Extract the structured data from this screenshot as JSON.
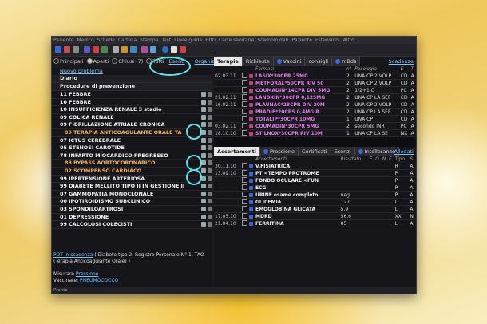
{
  "menu": [
    "Paziente",
    "Medico",
    "Schede",
    "Cartella",
    "Stampa",
    "Test",
    "Linee guida",
    "Filtri",
    "Carte sanitarie",
    "Scambio dati",
    "Paziente",
    "Estensioni",
    "Altro"
  ],
  "filters": {
    "options": [
      "Principali",
      "Aperti",
      "Chiusi (7)",
      "Tutti"
    ],
    "esenti_link": "Esenti",
    "organizza_link": "Organizza"
  },
  "left": {
    "new_problem": "Nuovo problema",
    "headers": [
      "Diario",
      "Procedure di prevenzione"
    ],
    "problems": [
      {
        "label": "11 FEBBRE",
        "sub": false
      },
      {
        "label": "10 FEBBRE",
        "sub": false
      },
      {
        "label": "10 INSUFFICIENZA RENALE 3 stadio",
        "sub": false
      },
      {
        "label": "09 COLICA RENALE",
        "sub": false
      },
      {
        "label": "09 FIBRILLAZIONE ATRIALE CRONICA",
        "sub": false
      },
      {
        "label": "09 TERAPIA ANTICOAGULANTE ORALE TA",
        "sub": true
      },
      {
        "label": "07 ICTUS CEREBRALE",
        "sub": false
      },
      {
        "label": "05 STENOSI CAROTIDE",
        "sub": false
      },
      {
        "label": "78 INFARTO MIOCARDICO PREGRESSO",
        "sub": false
      },
      {
        "label": "83 BYPASS AORTOCORONARICO",
        "sub": true
      },
      {
        "label": "02 SCOMPENSO CARDIACO",
        "sub": true
      },
      {
        "label": "99 IPERTENSIONE ARTERIOSA",
        "sub": false
      },
      {
        "label": "99 DIABETE MELLITO TIPO II IN GESTIONE II",
        "sub": false
      },
      {
        "label": "07 GAMMOPATIA MONOCLONALE",
        "sub": false
      },
      {
        "label": "00 IPOTIROIDISMO SUBCLINICO",
        "sub": false
      },
      {
        "label": "03 SPONDILOARTROSI",
        "sub": false
      },
      {
        "label": "01 DEPRESSIONE",
        "sub": false
      },
      {
        "label": "99 CALCOLOSI COLECISTI",
        "sub": false
      }
    ],
    "footer": {
      "pdt_link": "PDT in scadenza",
      "pdt_rest": "( Diabete tipo 2, Registro Personale N° 1, TAO (Terapia Anticoagulante Orale) )",
      "misurare_label": "Misurare",
      "misurare_link": "Pressione",
      "vaccinare_label": "Vaccinare:",
      "vaccinare_link": "PNEUMOCOCCO"
    }
  },
  "therapy": {
    "tabs": [
      "Terapie",
      "Richieste",
      "Vaccini",
      "consigli",
      "mBds"
    ],
    "scadenze_link": "Scadenze",
    "columns": [
      "Farmaci",
      "n°",
      "Posologia",
      "E",
      "T"
    ],
    "rows": [
      {
        "date": "02.03.11",
        "name": "LASIX*30CPR 25MG",
        "n": "2",
        "pos": "UNA CP 2 VOLP",
        "e": "CD",
        "t": "A"
      },
      {
        "date": "",
        "name": "METFORAL*50CPR RIV 50",
        "n": "2",
        "pos": "UNA CP 2 VOLP",
        "e": "CD",
        "t": "A"
      },
      {
        "date": "",
        "name": "COUMADIN*14CPR DIV 5MG",
        "n": "2",
        "pos": "1/2+1 C",
        "e": "PC",
        "t": "A"
      },
      {
        "date": "21.02.11",
        "name": "LANOXIN*30CPR 0,125MG",
        "n": "2",
        "pos": "UNA CP LA SEF",
        "e": "CD",
        "t": "A"
      },
      {
        "date": "16.02.11",
        "name": "PLAUNAC*28CPR DIV 20M",
        "n": "2",
        "pos": "UNA CP 2 VOLP",
        "e": "CD",
        "t": "A"
      },
      {
        "date": "",
        "name": "PRADIF*20CPS 0,4MG R.",
        "n": "2",
        "pos": "UNA CP LA SEF",
        "e": "CD",
        "t": "A"
      },
      {
        "date": "",
        "name": "TOTALIP*30CPR 10MG",
        "n": "1",
        "pos": "UNA CP",
        "e": "CD",
        "t": "A"
      },
      {
        "date": "03.02.11",
        "name": "COUMADIN*30CPR 5MG",
        "n": "2",
        "pos": "secondo INR",
        "e": "PC",
        "t": "A"
      },
      {
        "date": "18.10.10",
        "name": "STILNOX*30CPR RIV 10M",
        "n": "1",
        "pos": "UNA CP LA SE",
        "e": "NX",
        "t": "A"
      }
    ]
  },
  "exams": {
    "tabs": [
      "Accertamenti",
      "Pressione",
      "Certificati",
      "Esenz.",
      "Intolleranze"
    ],
    "allegati_link": "Allegati",
    "columns": [
      "Accertamenti",
      "Risultato",
      "E",
      "O",
      "N",
      "E",
      "Tipo",
      "S"
    ],
    "rows": [
      {
        "date": "30.11.10",
        "name": "V.FISIATRICA",
        "res": "",
        "tipo": "R",
        "s": "A"
      },
      {
        "date": "13.09.10",
        "name": "PT <TEMPO PROTROME",
        "res": "",
        "tipo": "P",
        "s": "A"
      },
      {
        "date": "",
        "name": "FONDO OCULARE <FUN",
        "res": "",
        "tipo": "P",
        "s": "A"
      },
      {
        "date": "",
        "name": "ECG",
        "res": "",
        "tipo": "P",
        "s": "A"
      },
      {
        "date": "",
        "name": "URINE esame completo",
        "res": "neg",
        "tipo": "P",
        "s": "A"
      },
      {
        "date": "",
        "name": "GLICEMIA",
        "res": "127",
        "tipo": "L",
        "s": "A"
      },
      {
        "date": "",
        "name": "EMOGLOBINA GLICATA",
        "res": "5.9",
        "tipo": "L",
        "s": "A"
      },
      {
        "date": "17.05.10",
        "name": "MDRD",
        "res": "56.6",
        "tipo": "XX",
        "s": "N"
      },
      {
        "date": "21.04.10",
        "name": "FERRITINA",
        "res": "85",
        "tipo": "L",
        "s": "A"
      }
    ]
  },
  "status_text": "Pronto",
  "colors": {
    "highlight": "#5fe0e6",
    "link": "#7cc3ff",
    "drug": "#e07be8"
  }
}
